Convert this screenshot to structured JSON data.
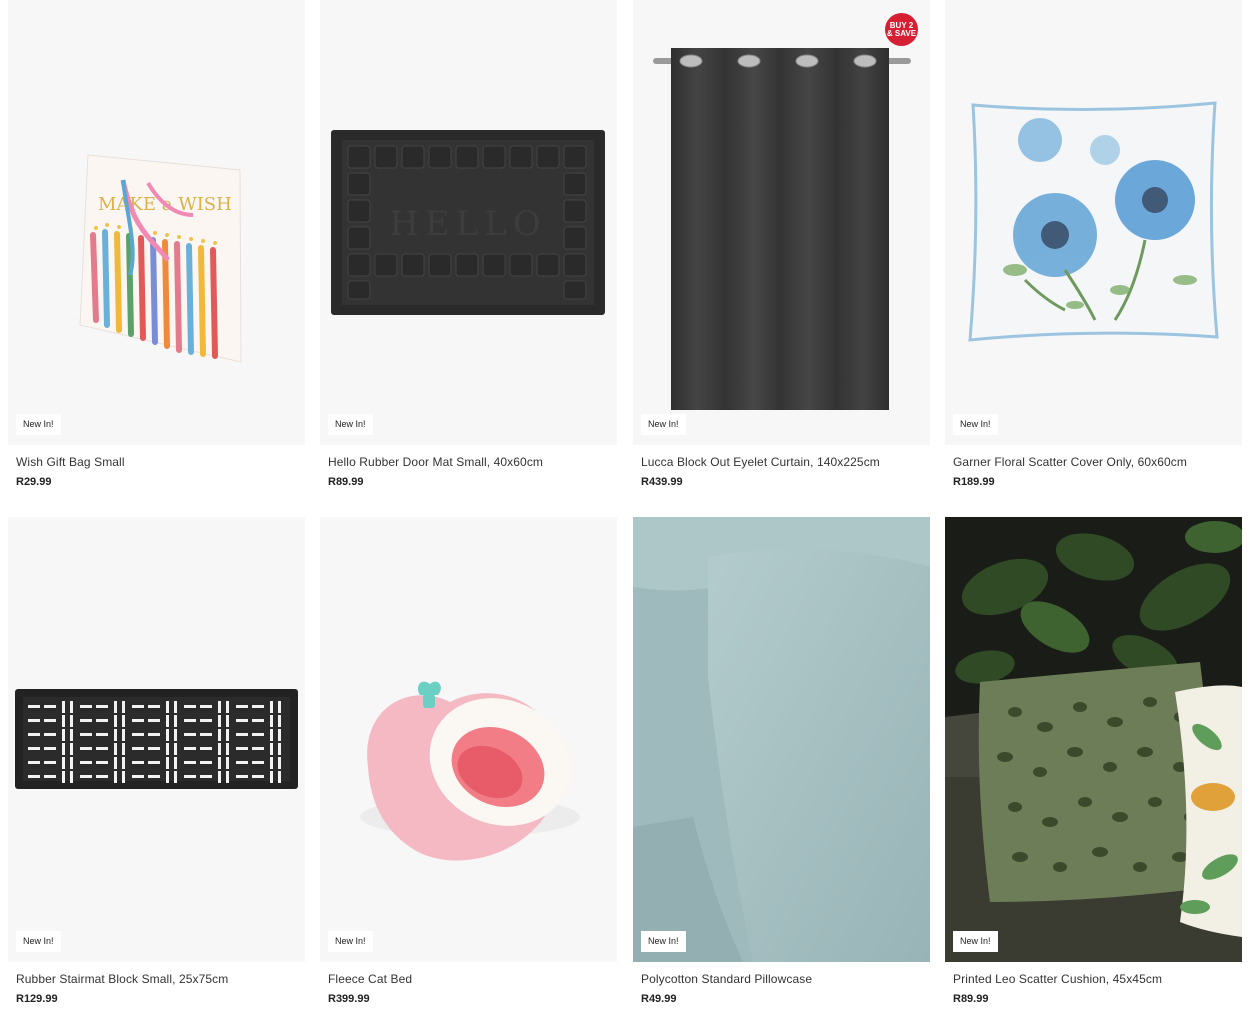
{
  "products": [
    {
      "name": "Wish Gift Bag Small",
      "price": "R29.99",
      "badge": "New In!",
      "image": "gift-bag"
    },
    {
      "name": "Hello Rubber Door Mat Small, 40x60cm",
      "price": "R89.99",
      "badge": "New In!",
      "image": "door-mat"
    },
    {
      "name": "Lucca Block Out Eyelet Curtain, 140x225cm",
      "price": "R439.99",
      "badge": "New In!",
      "image": "curtain",
      "promo_line1": "BUY 2",
      "promo_line2": "& SAVE"
    },
    {
      "name": "Garner Floral Scatter Cover Only, 60x60cm",
      "price": "R189.99",
      "badge": "New In!",
      "image": "floral-cushion"
    },
    {
      "name": "Rubber Stairmat Block Small, 25x75cm",
      "price": "R129.99",
      "badge": "New In!",
      "image": "stair-mat"
    },
    {
      "name": "Fleece Cat Bed",
      "price": "R399.99",
      "badge": "New In!",
      "image": "cat-bed"
    },
    {
      "name": "Polycotton Standard Pillowcase",
      "price": "R49.99",
      "badge": "New In!",
      "image": "pillowcase"
    },
    {
      "name": "Printed Leo Scatter Cushion, 45x45cm",
      "price": "R89.99",
      "badge": "New In!",
      "image": "leo-cushion"
    }
  ],
  "mat_text": "HELLO",
  "bag_text": "MAKE a WISH",
  "colors": {
    "promo": "#d61f32",
    "image_bg": "#f7f7f7"
  }
}
